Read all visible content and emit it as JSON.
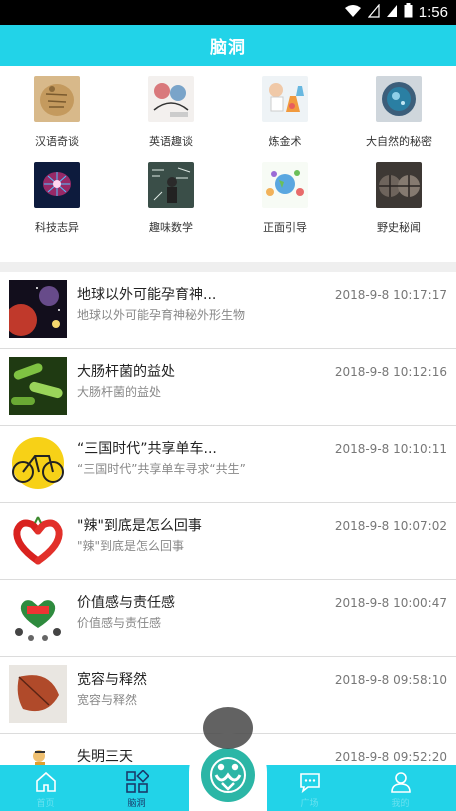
{
  "status_bar": {
    "time": "1:56"
  },
  "header": {
    "title": "脑洞"
  },
  "categories": [
    {
      "label": "汉语奇谈",
      "icon": "chinese-stories-thumb"
    },
    {
      "label": "英语趣谈",
      "icon": "english-fun-thumb"
    },
    {
      "label": "炼金术",
      "icon": "alchemy-thumb"
    },
    {
      "label": "大自然的秘密",
      "icon": "nature-secrets-thumb"
    },
    {
      "label": "科技志异",
      "icon": "tech-oddities-thumb"
    },
    {
      "label": "趣味数学",
      "icon": "fun-math-thumb"
    },
    {
      "label": "正面引导",
      "icon": "positive-guidance-thumb"
    },
    {
      "label": "野史秘闻",
      "icon": "unofficial-history-thumb"
    }
  ],
  "articles": [
    {
      "title": "地球以外可能孕育神...",
      "subtitle": "地球以外可能孕育神秘外形生物",
      "date": "2018-9-8 10:17:17"
    },
    {
      "title": "大肠杆菌的益处",
      "subtitle": "大肠杆菌的益处",
      "date": "2018-9-8 10:12:16"
    },
    {
      "title": "“三国时代”共享单车...",
      "subtitle": "“三国时代”共享单车寻求“共生”",
      "date": "2018-9-8 10:10:11"
    },
    {
      "title": "\"辣\"到底是怎么回事",
      "subtitle": "\"辣\"到底是怎么回事",
      "date": "2018-9-8 10:07:02"
    },
    {
      "title": "价值感与责任感",
      "subtitle": "价值感与责任感",
      "date": "2018-9-8 10:00:47"
    },
    {
      "title": "宽容与释然",
      "subtitle": "宽容与释然",
      "date": "2018-9-8 09:58:10"
    },
    {
      "title": "失明三天",
      "subtitle": "",
      "date": "2018-9-8 09:52:20"
    }
  ],
  "bottom_nav": {
    "items": [
      {
        "label": "首页",
        "icon": "home-icon",
        "active": false
      },
      {
        "label": "脑洞",
        "icon": "brain-hole-icon",
        "active": true
      },
      {
        "label": "广场",
        "icon": "chat-icon",
        "active": false
      },
      {
        "label": "我的",
        "icon": "profile-icon",
        "active": false
      }
    ]
  },
  "colors": {
    "accent": "#22d3e8",
    "active_nav": "#1a3b6b",
    "logo": "#2bb6a6"
  }
}
